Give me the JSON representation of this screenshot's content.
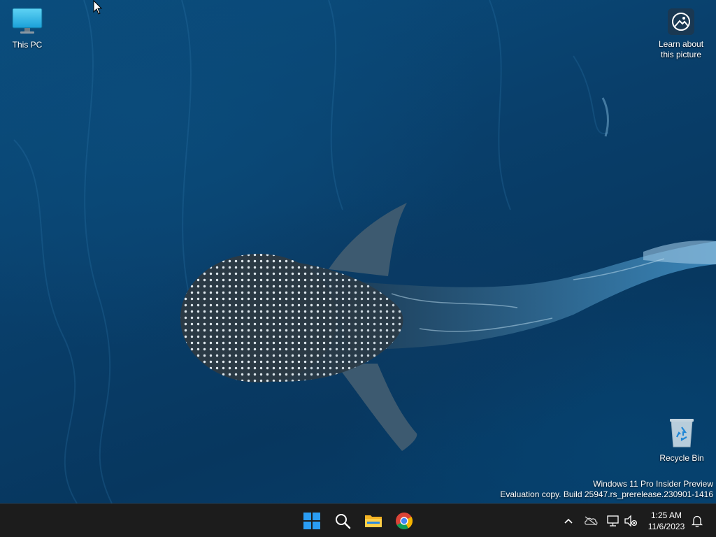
{
  "desktop": {
    "icons": [
      {
        "label": "This PC",
        "icon": "monitor-icon"
      },
      {
        "label": "Learn about\nthis picture",
        "icon": "camera-info-icon"
      },
      {
        "label": "Recycle Bin",
        "icon": "recycle-bin-icon"
      }
    ],
    "watermark": {
      "line1": "Windows 11 Pro Insider Preview",
      "line2": "Evaluation copy. Build 25947.rs_prerelease.230901-1416"
    }
  },
  "taskbar": {
    "apps": [
      {
        "name": "Start",
        "icon": "windows-logo-icon"
      },
      {
        "name": "Search",
        "icon": "search-icon"
      },
      {
        "name": "File Explorer",
        "icon": "folder-icon"
      },
      {
        "name": "Google Chrome",
        "icon": "chrome-icon"
      }
    ],
    "tray": {
      "icons": [
        "chevron-up-icon",
        "onedrive-icon",
        "network-icon",
        "volume-muted-icon",
        "notification-bell-icon"
      ],
      "time": "1:25 AM",
      "date": "11/6/2023"
    }
  },
  "colors": {
    "taskbar_bg": "#1c1c1c",
    "wallpaper_blue": "#0a4f80",
    "start_blue": "#2a9df4"
  }
}
